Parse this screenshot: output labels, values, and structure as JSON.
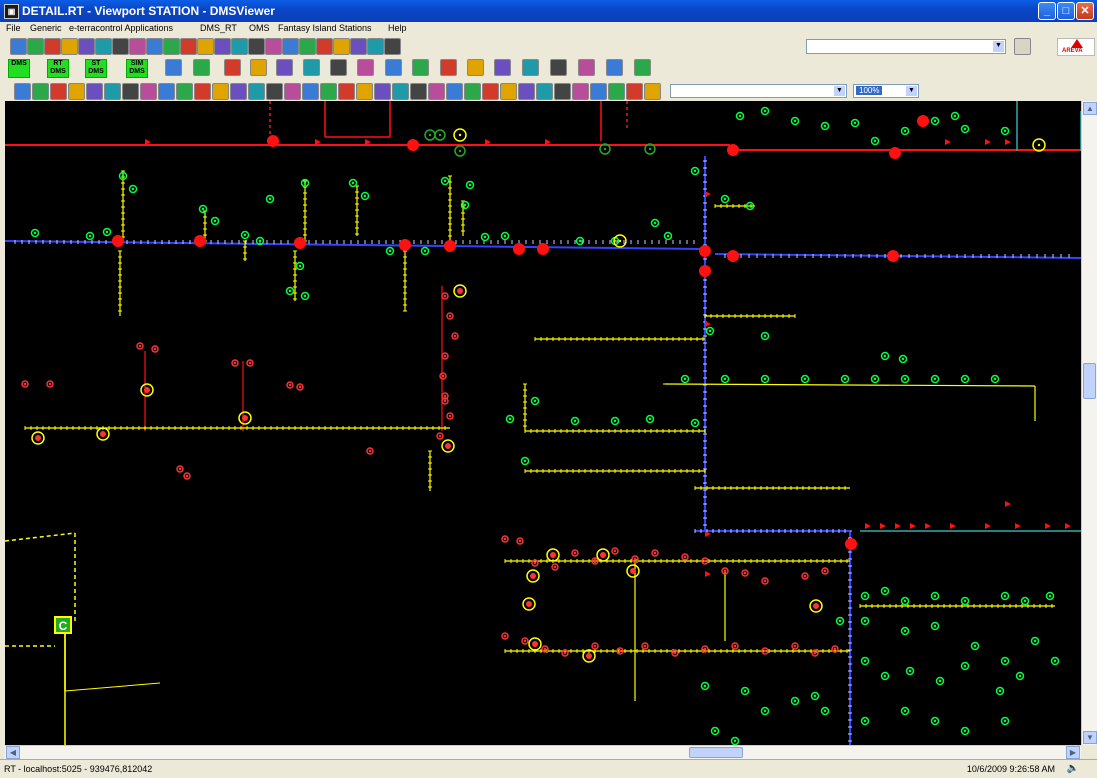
{
  "window": {
    "title": "DETAIL.RT - Viewport STATION - DMSViewer",
    "minimize": "_",
    "maximize": "□",
    "close": "✕"
  },
  "menu": [
    "File",
    "Generic",
    "e-terracontrol Applications",
    "DMS_RT",
    "OMS",
    "Fantasy Island Stations",
    "Help"
  ],
  "toolbar": {
    "dms_buttons": [
      "DMS",
      "RT DMS",
      "ST DMS",
      "SIM DMS"
    ],
    "zoom_value": "100%",
    "brand": "AREVA"
  },
  "map": {
    "marker_label": "C"
  },
  "status": {
    "left": "RT - localhost:5025 - 939476,812042",
    "right": "10/6/2009 9:26:58 AM"
  },
  "colors": {
    "canvas_bg": "#000000",
    "feeder_red": "#ff1111",
    "blue_bus": "#3344ff",
    "green_device": "#00ff44",
    "yellow_service": "#ffff00",
    "title_blue": "#0a5ee6"
  }
}
